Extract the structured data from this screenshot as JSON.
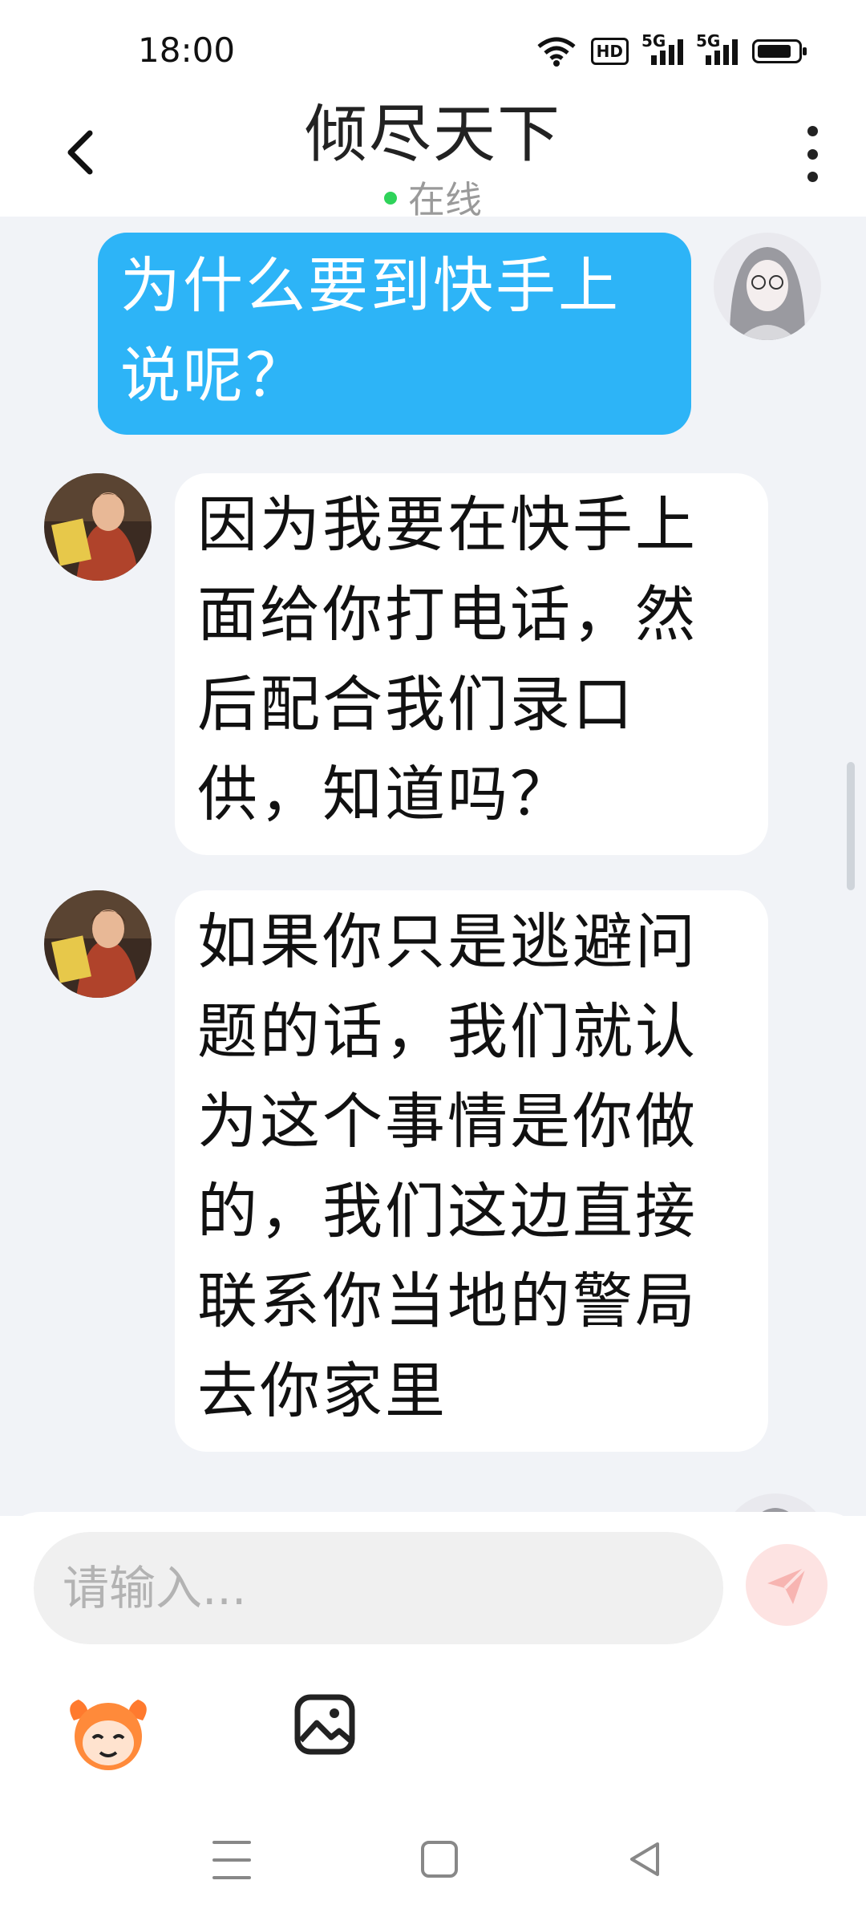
{
  "status_bar": {
    "time": "18:00",
    "icons": [
      "wifi-icon",
      "hd-icon",
      "signal-5g-icon",
      "signal-5g-icon",
      "battery-icon"
    ],
    "hd_label": "HD",
    "signal_label": "5G",
    "battery_level": 0.85
  },
  "header": {
    "contact_name": "倾尽天下",
    "presence": "在线",
    "presence_color": "#2fd35a",
    "back_icon": "chevron-left-icon",
    "more_icon": "more-vertical-icon"
  },
  "messages": [
    {
      "sender": "me",
      "text": "为什么要到快手上\n说呢？"
    },
    {
      "sender": "them",
      "text": "因为我要在快手上\n面给你打电话，然\n后配合我们录口\n供，知道吗？"
    },
    {
      "sender": "them",
      "text": "如果你只是逃避问\n题的话，我们就认\n为这个事情是你做\n的，我们这边直接\n联系你当地的警局\n去你家里"
    }
  ],
  "composer": {
    "placeholder": "请输入...",
    "send_icon": "send-icon",
    "emoji_icon": "emoji-mascot-icon",
    "image_icon": "image-icon"
  },
  "colors": {
    "my_bubble": "#2db4f7",
    "their_bubble": "#ffffff",
    "chat_background": "#f1f3f7"
  },
  "nav_bar": [
    "menu-icon",
    "home-icon",
    "back-triangle-icon"
  ]
}
